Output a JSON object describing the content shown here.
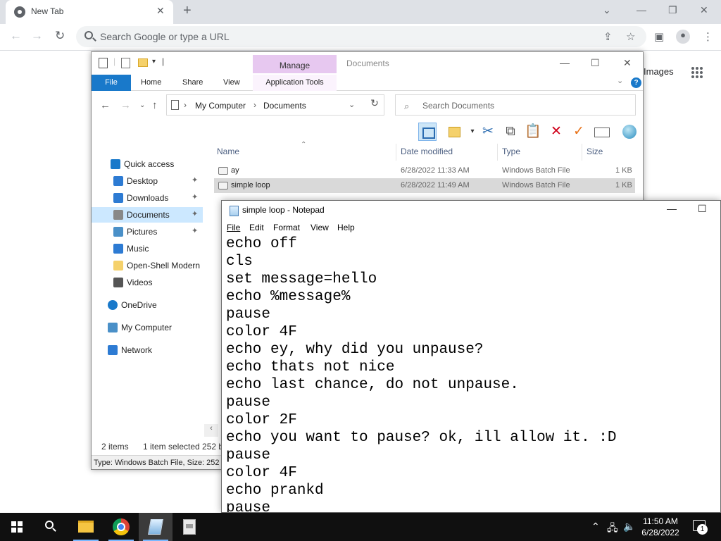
{
  "chrome": {
    "tab_title": "New Tab",
    "omnibox_placeholder": "Search Google or type a URL",
    "images_link": "Images"
  },
  "explorer": {
    "title": "Documents",
    "context_tab": "Manage",
    "ribbon_tabs": [
      "File",
      "Home",
      "Share",
      "View",
      "Application Tools"
    ],
    "breadcrumb": [
      "My Computer",
      "Documents"
    ],
    "search_placeholder": "Search Documents",
    "nav": [
      {
        "label": "Quick access",
        "icon": "star-icon",
        "color": "#1979ca"
      },
      {
        "label": "Desktop",
        "icon": "desktop-icon",
        "pinned": true,
        "color": "#2d7bd3"
      },
      {
        "label": "Downloads",
        "icon": "download-icon",
        "pinned": true,
        "color": "#2d7bd3"
      },
      {
        "label": "Documents",
        "icon": "documents-icon",
        "pinned": true,
        "selected": true,
        "color": "#888888"
      },
      {
        "label": "Pictures",
        "icon": "pictures-icon",
        "pinned": true,
        "color": "#4a90c8"
      },
      {
        "label": "Music",
        "icon": "music-icon",
        "color": "#2d7bd3"
      },
      {
        "label": "Open-Shell Modern",
        "icon": "folder-icon",
        "color": "#f5d16b"
      },
      {
        "label": "Videos",
        "icon": "videos-icon",
        "color": "#555555"
      },
      {
        "label": "OneDrive",
        "icon": "cloud-icon",
        "color": "#1979ca"
      },
      {
        "label": "My Computer",
        "icon": "computer-icon",
        "color": "#4a90c8"
      },
      {
        "label": "Network",
        "icon": "network-icon",
        "color": "#2d7bd3"
      }
    ],
    "columns": [
      "Name",
      "Date modified",
      "Type",
      "Size"
    ],
    "files": [
      {
        "name": "ay",
        "date": "6/28/2022 11:33 AM",
        "type": "Windows Batch File",
        "size": "1 KB",
        "selected": false
      },
      {
        "name": "simple loop",
        "date": "6/28/2022 11:49 AM",
        "type": "Windows Batch File",
        "size": "1 KB",
        "selected": true
      }
    ],
    "status_items": "2 items",
    "status_selected": "1 item selected  252 b",
    "info_bar": "Type: Windows Batch File, Size: 252"
  },
  "notepad": {
    "title": "simple loop - Notepad",
    "menus": [
      "File",
      "Edit",
      "Format",
      "View",
      "Help"
    ],
    "content": "echo off\ncls\nset message=hello\necho %message%\npause\ncolor 4F\necho ey, why did you unpause?\necho thats not nice\necho last chance, do not unpause.\npause\ncolor 2F\necho you want to pause? ok, ill allow it. :D\npause\ncolor 4F\necho prankd\npause"
  },
  "taskbar": {
    "time": "11:50 AM",
    "date": "6/28/2022",
    "notification_count": "1"
  }
}
